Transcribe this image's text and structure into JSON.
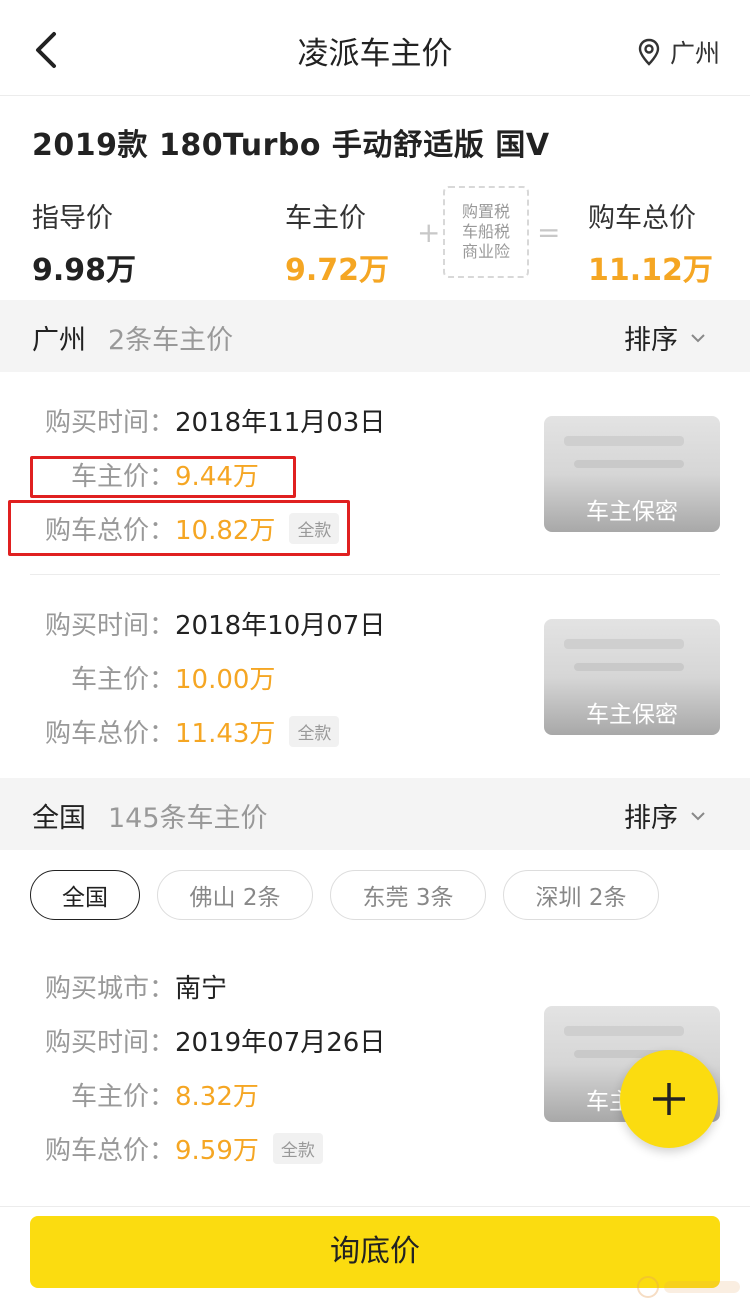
{
  "header": {
    "title": "凌派车主价",
    "location": "广州"
  },
  "car": {
    "model": "2019款 180Turbo 手动舒适版 国V",
    "guide_label": "指导价",
    "guide_value": "9.98万",
    "owner_label": "车主价",
    "owner_value": "9.72万",
    "plus": "+",
    "tax_lines": [
      "购置税",
      "车船税",
      "商业险"
    ],
    "equals": "=",
    "total_label": "购车总价",
    "total_value": "11.12万"
  },
  "section_local": {
    "city": "广州",
    "count": "2条车主价",
    "sort": "排序"
  },
  "records_local": [
    {
      "time_label": "购买时间：",
      "time_value": "2018年11月03日",
      "owner_label": "车主价：",
      "owner_value": "9.44万",
      "total_label": "购车总价：",
      "total_value": "10.82万",
      "tag": "全款",
      "thumb_text": "车主保密"
    },
    {
      "time_label": "购买时间：",
      "time_value": "2018年10月07日",
      "owner_label": "车主价：",
      "owner_value": "10.00万",
      "total_label": "购车总价：",
      "total_value": "11.43万",
      "tag": "全款",
      "thumb_text": "车主保密"
    }
  ],
  "section_national": {
    "city": "全国",
    "count": "145条车主价",
    "sort": "排序"
  },
  "chips": [
    "全国",
    "佛山 2条",
    "东莞 3条",
    "深圳 2条"
  ],
  "record_national": {
    "city_label": "购买城市：",
    "city_value": "南宁",
    "time_label": "购买时间：",
    "time_value": "2019年07月26日",
    "owner_label": "车主价：",
    "owner_value": "8.32万",
    "total_label": "购车总价：",
    "total_value": "9.59万",
    "tag": "全款",
    "thumb_text": "车主保密"
  },
  "cta": "询底价",
  "colors": {
    "accent": "#fbdc10",
    "price": "#f5a623",
    "highlight": "#e02020"
  }
}
